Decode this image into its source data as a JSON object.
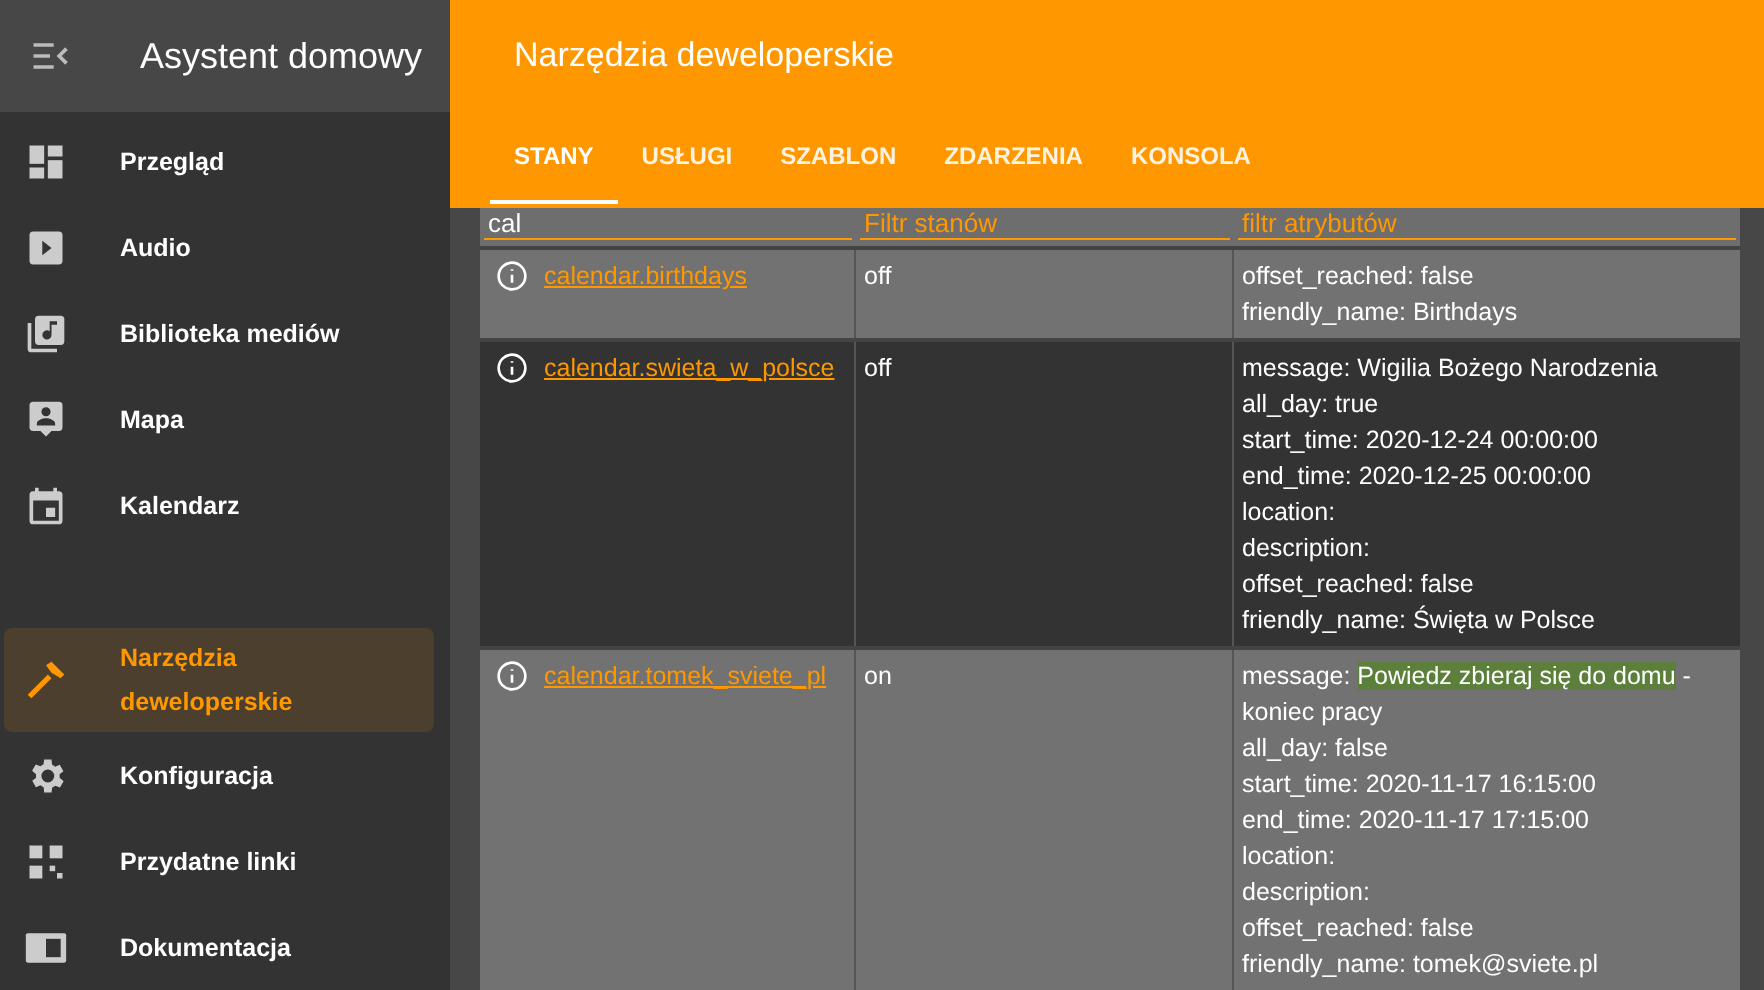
{
  "sidebar": {
    "title": "Asystent domowy",
    "items": [
      {
        "label": "Przegląd",
        "selected": false
      },
      {
        "label": "Audio",
        "selected": false
      },
      {
        "label": "Biblioteka mediów",
        "selected": false
      },
      {
        "label": "Mapa",
        "selected": false
      },
      {
        "label": "Kalendarz",
        "selected": false
      }
    ],
    "bottom_items": [
      {
        "label": "Narzędzia deweloperskie",
        "selected": true
      },
      {
        "label": "Konfiguracja",
        "selected": false
      },
      {
        "label": "Przydatne linki",
        "selected": false
      },
      {
        "label": "Dokumentacja",
        "selected": false
      }
    ]
  },
  "header": {
    "title": "Narzędzia deweloperskie"
  },
  "tabs": [
    {
      "label": "STANY",
      "selected": true
    },
    {
      "label": "USŁUGI",
      "selected": false
    },
    {
      "label": "SZABLON",
      "selected": false
    },
    {
      "label": "ZDARZENIA",
      "selected": false
    },
    {
      "label": "KONSOLA",
      "selected": false
    }
  ],
  "filters": [
    {
      "value": "cal"
    },
    {
      "placeholder": "Filtr stanów"
    },
    {
      "placeholder": "filtr atrybutów"
    }
  ],
  "rows": [
    {
      "entity": "calendar.birthdays",
      "state": "off",
      "attributes": [
        {
          "text": "offset_reached: false"
        },
        {
          "text": "friendly_name: Birthdays"
        }
      ]
    },
    {
      "entity": "calendar.swieta_w_polsce",
      "state": "off",
      "attributes": [
        {
          "text": "message: Wigilia Bożego Narodzenia"
        },
        {
          "text": "all_day: true"
        },
        {
          "text": "start_time: 2020-12-24 00:00:00"
        },
        {
          "text": "end_time: 2020-12-25 00:00:00"
        },
        {
          "text": "location:"
        },
        {
          "text": "description:"
        },
        {
          "text": "offset_reached: false"
        },
        {
          "text": "friendly_name: Święta w Polsce"
        }
      ]
    },
    {
      "entity": "calendar.tomek_sviete_pl",
      "state": "on",
      "attributes": [
        {
          "text": "message: ",
          "highlight": "Powiedz zbieraj się do domu",
          "after": " - koniec pracy"
        },
        {
          "text": "all_day: false"
        },
        {
          "text": "start_time: 2020-11-17 16:15:00"
        },
        {
          "text": "end_time: 2020-11-17 17:15:00"
        },
        {
          "text": "location:"
        },
        {
          "text": "description:"
        },
        {
          "text": "offset_reached: false"
        },
        {
          "text": "friendly_name: tomek@sviete.pl"
        }
      ]
    }
  ]
}
